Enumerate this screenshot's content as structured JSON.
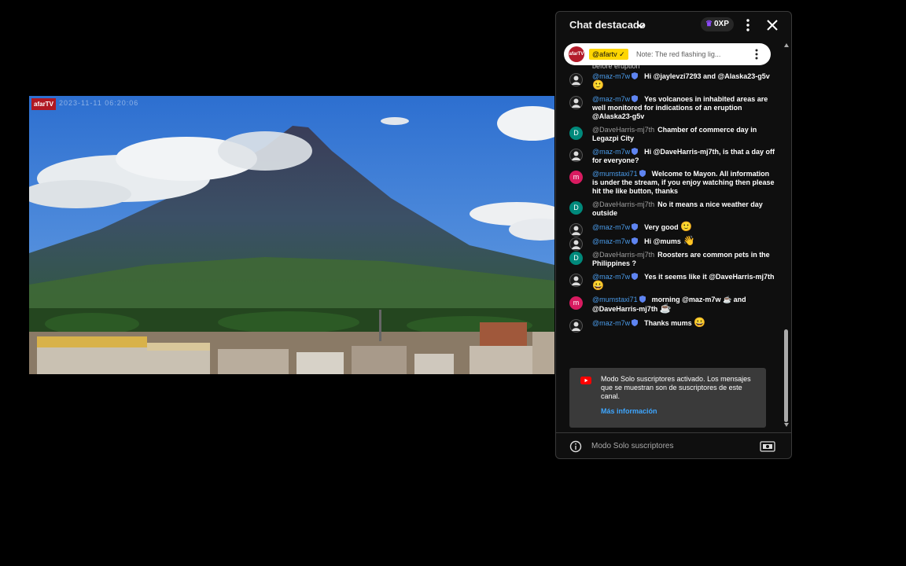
{
  "video": {
    "channel_logo": "afarTV",
    "overlay_stamp": "2023-11-11 06:20:06"
  },
  "chat": {
    "title": "Chat destacado",
    "xp_badge": "0XP",
    "pinned": {
      "author": "@afartv",
      "text": "Note: The red flashing lig..."
    },
    "partial_line": "before eruption",
    "messages": [
      {
        "author": "@maz-m7w",
        "mod": true,
        "avatar": "dark",
        "text": "Hi @jaylevzi7293 and @Alaska23-g5v",
        "emoji": "🙂"
      },
      {
        "author": "@maz-m7w",
        "mod": true,
        "avatar": "dark",
        "text": "Yes volcanoes in inhabited areas are well monitored for indications of an eruption @Alaska23-g5v",
        "emoji": ""
      },
      {
        "author": "@DaveHarris-mj7th",
        "mod": false,
        "avatar": "teal",
        "initial": "D",
        "text": "Chamber of commerce day in Legazpi City",
        "emoji": ""
      },
      {
        "author": "@maz-m7w",
        "mod": true,
        "avatar": "dark",
        "text": "Hi @DaveHarris-mj7th, is that a day off for everyone?",
        "emoji": ""
      },
      {
        "author": "@mumstaxi71",
        "mod": true,
        "avatar": "pink",
        "initial": "m",
        "text": "Welcome to Mayon. All information is under the stream, if you enjoy watching then please hit the like button, thanks",
        "emoji": ""
      },
      {
        "author": "@DaveHarris-mj7th",
        "mod": false,
        "avatar": "teal",
        "initial": "D",
        "text": "No it means a nice weather day outside",
        "emoji": ""
      },
      {
        "author": "@maz-m7w",
        "mod": true,
        "avatar": "dark",
        "text": "Very good",
        "emoji": "🙂"
      },
      {
        "author": "@maz-m7w",
        "mod": true,
        "avatar": "dark",
        "text": "Hi @mums",
        "emoji": "👋"
      },
      {
        "author": "@DaveHarris-mj7th",
        "mod": false,
        "avatar": "teal",
        "initial": "D",
        "text": "Roosters are common pets in the Philippines ?",
        "emoji": ""
      },
      {
        "author": "@maz-m7w",
        "mod": true,
        "avatar": "dark",
        "text": "Yes it seems like it @DaveHarris-mj7th",
        "emoji": "😀"
      },
      {
        "author": "@mumstaxi71",
        "mod": true,
        "avatar": "pink",
        "initial": "m",
        "text": "morning @maz-m7w ☕ and @DaveHarris-mj7th",
        "emoji": "☕"
      },
      {
        "author": "@maz-m7w",
        "mod": true,
        "avatar": "dark",
        "text": "Thanks mums",
        "emoji": "😀"
      }
    ],
    "notice": {
      "text": "Modo Solo suscriptores activado. Los mensajes que se muestran son de suscriptores de este canal.",
      "link": "Más información"
    },
    "footer_text": "Modo Solo suscriptores"
  }
}
